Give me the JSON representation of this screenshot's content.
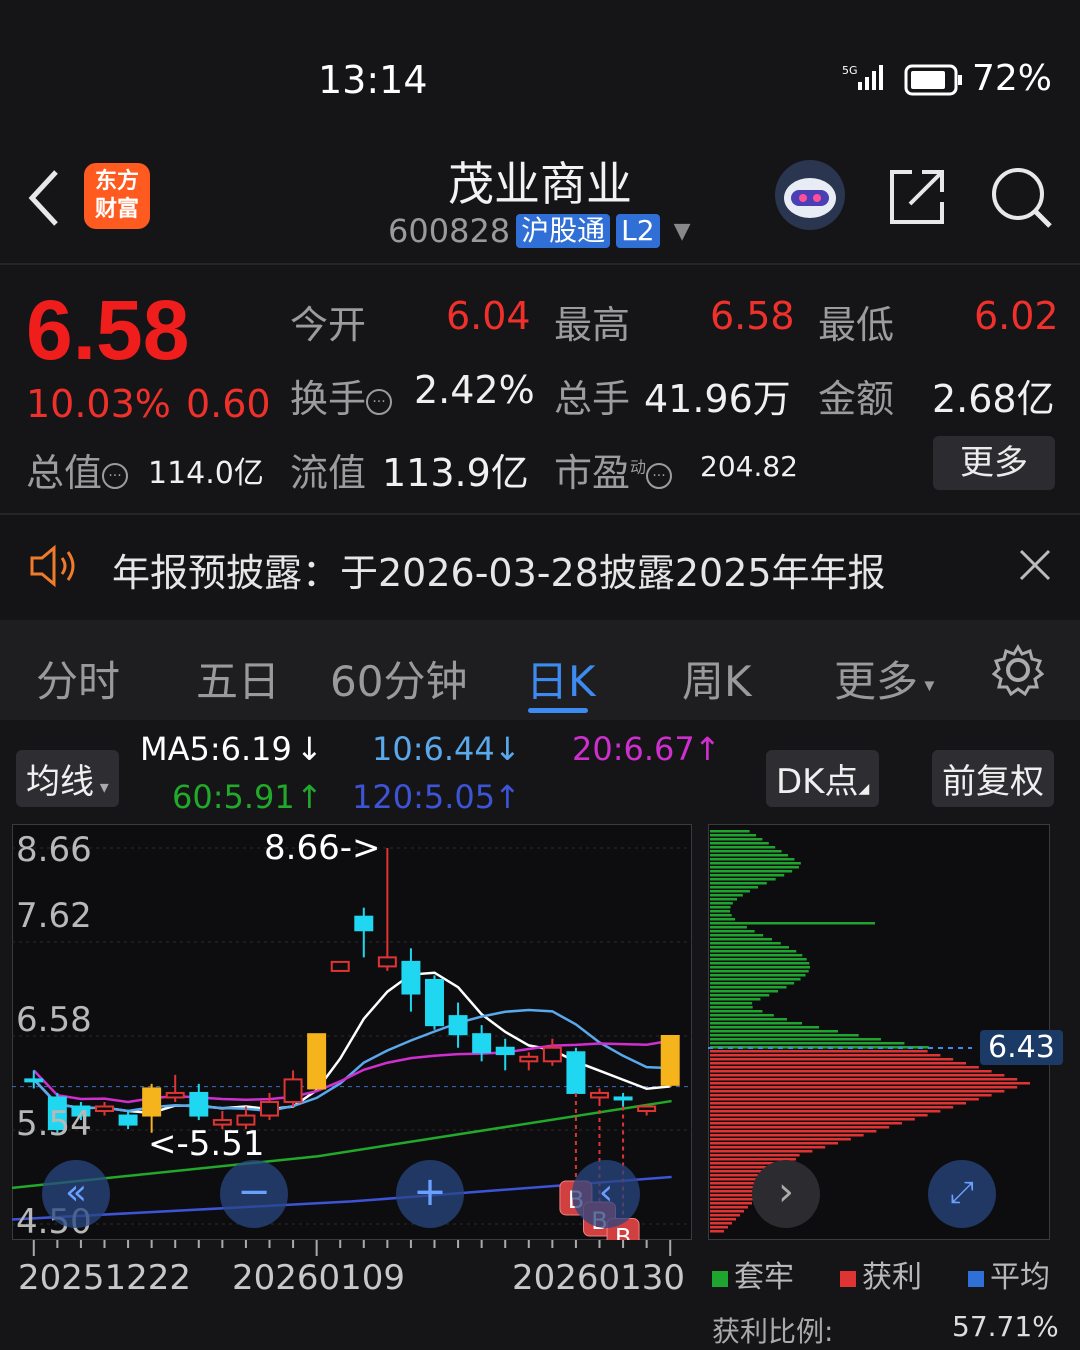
{
  "status": {
    "time": "13:14",
    "network": "5G",
    "battery": "72%"
  },
  "header": {
    "logo_line1": "东方",
    "logo_line2": "财富",
    "title": "茂业商业",
    "code": "600828",
    "tag1": "沪股通",
    "tag2": "L2"
  },
  "quote": {
    "price": "6.58",
    "change_pct": "10.03%",
    "change": "0.60",
    "open_label": "今开",
    "open": "6.04",
    "high_label": "最高",
    "high": "6.58",
    "low_label": "最低",
    "low": "6.02",
    "turnover_label": "换手",
    "turnover": "2.42%",
    "volume_label": "总手",
    "volume": "41.96万",
    "amount_label": "金额",
    "amount": "2.68亿",
    "mktcap_label": "总值",
    "mktcap": "114.0亿",
    "float_label": "流值",
    "float": "113.9亿",
    "pe_label": "市盈",
    "pe_sup": "动",
    "pe": "204.82",
    "more": "更多"
  },
  "notice": {
    "text": "年报预披露：于2026-03-28披露2025年年报"
  },
  "tabs": [
    "分时",
    "五日",
    "60分钟",
    "日K",
    "周K",
    "更多"
  ],
  "active_tab": "日K",
  "chart_controls": {
    "ma_button": "均线",
    "dk_button": "DK点",
    "adjust_button": "前复权"
  },
  "ma_values": {
    "ma5": "MA5:6.19",
    "ma10": "10:6.44",
    "ma20": "20:6.67",
    "ma60": "60:5.91",
    "ma120": "120:5.05",
    "colors": {
      "ma5": "#ffffff",
      "ma10": "#5aa9ec",
      "ma20": "#d02fd0",
      "ma60": "#22a82a",
      "ma120": "#3d54d6"
    }
  },
  "chart_data": {
    "type": "candlestick",
    "y_ticks": [
      "8.66",
      "7.62",
      "6.58",
      "5.54",
      "4.50"
    ],
    "ylim": [
      4.5,
      8.66
    ],
    "x_labels": [
      "20251222",
      "20260109",
      "20260130"
    ],
    "annotations": {
      "high": "8.66->",
      "low": "<-5.51"
    },
    "markers": [
      "B",
      "B",
      "B"
    ],
    "candles": [
      {
        "o": 6.1,
        "c": 6.1,
        "h": 6.2,
        "l": 6.0,
        "up": false
      },
      {
        "o": 5.9,
        "c": 5.55,
        "h": 5.95,
        "l": 5.5,
        "up": false
      },
      {
        "o": 5.8,
        "c": 5.7,
        "h": 5.85,
        "l": 5.65,
        "up": false
      },
      {
        "o": 5.75,
        "c": 5.8,
        "h": 5.85,
        "l": 5.7,
        "up": true
      },
      {
        "o": 5.7,
        "c": 5.6,
        "h": 5.75,
        "l": 5.55,
        "up": false
      },
      {
        "o": 5.7,
        "c": 6.0,
        "h": 6.05,
        "l": 5.51,
        "up": true
      },
      {
        "o": 5.9,
        "c": 5.95,
        "h": 6.15,
        "l": 5.85,
        "up": true
      },
      {
        "o": 5.95,
        "c": 5.7,
        "h": 6.05,
        "l": 5.65,
        "up": false
      },
      {
        "o": 5.6,
        "c": 5.65,
        "h": 5.75,
        "l": 5.55,
        "up": true
      },
      {
        "o": 5.6,
        "c": 5.7,
        "h": 5.8,
        "l": 5.55,
        "up": true
      },
      {
        "o": 5.7,
        "c": 5.85,
        "h": 5.95,
        "l": 5.65,
        "up": true
      },
      {
        "o": 5.85,
        "c": 6.1,
        "h": 6.2,
        "l": 5.8,
        "up": true
      },
      {
        "o": 6.0,
        "c": 6.6,
        "h": 6.6,
        "l": 6.0,
        "up": true
      },
      {
        "o": 7.3,
        "c": 7.4,
        "h": 7.4,
        "l": 7.3,
        "up": true
      },
      {
        "o": 7.75,
        "c": 7.9,
        "h": 8.0,
        "l": 7.45,
        "up": false
      },
      {
        "o": 7.45,
        "c": 7.35,
        "h": 8.66,
        "l": 7.3,
        "up": true
      },
      {
        "o": 7.4,
        "c": 7.05,
        "h": 7.55,
        "l": 6.85,
        "up": false
      },
      {
        "o": 7.2,
        "c": 6.7,
        "h": 7.25,
        "l": 6.65,
        "up": false
      },
      {
        "o": 6.8,
        "c": 6.6,
        "h": 6.95,
        "l": 6.45,
        "up": false
      },
      {
        "o": 6.6,
        "c": 6.4,
        "h": 6.7,
        "l": 6.3,
        "up": false
      },
      {
        "o": 6.45,
        "c": 6.38,
        "h": 6.55,
        "l": 6.2,
        "up": false
      },
      {
        "o": 6.35,
        "c": 6.3,
        "h": 6.4,
        "l": 6.2,
        "up": true
      },
      {
        "o": 6.3,
        "c": 6.45,
        "h": 6.55,
        "l": 6.25,
        "up": true
      },
      {
        "o": 6.4,
        "c": 5.95,
        "h": 6.45,
        "l": 5.95,
        "up": false
      },
      {
        "o": 5.95,
        "c": 5.9,
        "h": 6.0,
        "l": 5.85,
        "up": true
      },
      {
        "o": 5.9,
        "c": 5.88,
        "h": 5.95,
        "l": 5.8,
        "up": false
      },
      {
        "o": 5.75,
        "c": 5.8,
        "h": 5.82,
        "l": 5.7,
        "up": true
      },
      {
        "o": 6.04,
        "c": 6.58,
        "h": 6.58,
        "l": 6.02,
        "up": true
      }
    ]
  },
  "chips": {
    "current_price": "6.43",
    "legend": [
      "套牢",
      "获利",
      "平均"
    ],
    "legend_colors": [
      "#1fa52f",
      "#e03434",
      "#2f6fd6"
    ],
    "profit_label": "获利比例:",
    "profit_value": "57.71%"
  }
}
